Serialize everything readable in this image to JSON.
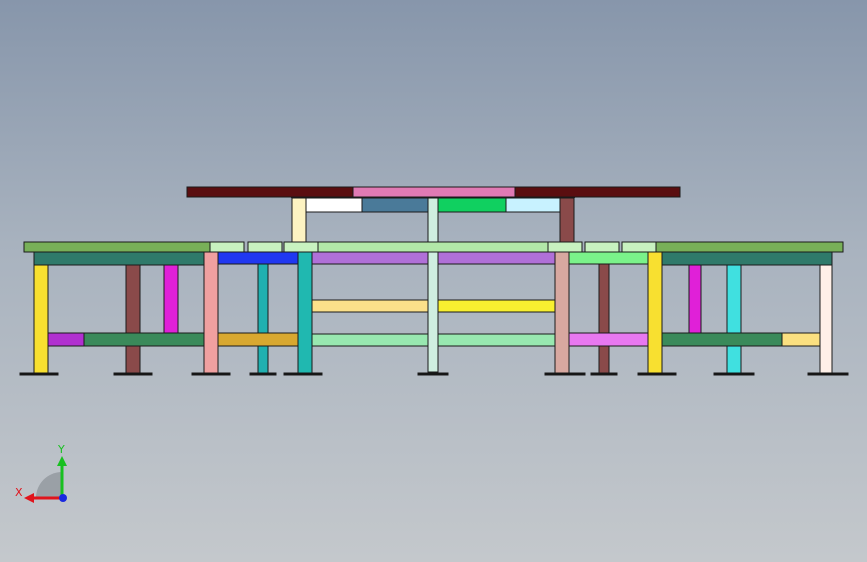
{
  "viewport": {
    "background_top": "#8796ab",
    "background_bottom": "#c4c8cc"
  },
  "triad": {
    "x_label": "X",
    "y_label": "Y",
    "x_color": "#e0141c",
    "y_color": "#18c020",
    "z_color": "#1828e0"
  }
}
